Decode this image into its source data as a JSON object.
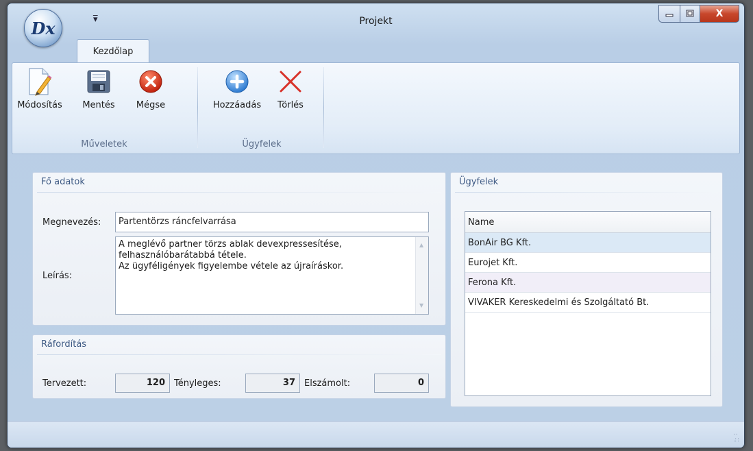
{
  "window": {
    "title": "Projekt",
    "app_logo_text": "Dx",
    "qat_icon": "qat-dropdown-icon",
    "close_glyph": "X"
  },
  "ribbon": {
    "tab": "Kezdőlap",
    "groups": [
      {
        "label": "Műveletek",
        "buttons": [
          {
            "label": "Módosítás",
            "icon": "edit-document-icon"
          },
          {
            "label": "Mentés",
            "icon": "save-disk-icon"
          },
          {
            "label": "Mégse",
            "icon": "cancel-icon"
          }
        ]
      },
      {
        "label": "Ügyfelek",
        "buttons": [
          {
            "label": "Hozzáadás",
            "icon": "add-icon"
          },
          {
            "label": "Törlés",
            "icon": "delete-icon"
          }
        ]
      }
    ]
  },
  "main_data": {
    "title": "Fő adatok",
    "name_label": "Megnevezés:",
    "name_value": "Partentörzs ráncfelvarrása",
    "desc_label": "Leírás:",
    "desc_lines": [
      "A meglévő partner törzs ablak devexpressesítése,",
      "felhasználóbarátabbá tétele.",
      "Az ügyféligények figyelembe vétele az újraíráskor."
    ]
  },
  "effort": {
    "title": "Ráfordítás",
    "planned_label": "Tervezett:",
    "planned_value": "120",
    "actual_label": "Tényleges:",
    "actual_value": "37",
    "billed_label": "Elszámolt:",
    "billed_value": "0"
  },
  "customers": {
    "title": "Ügyfelek",
    "column": "Name",
    "rows": [
      "BonAir BG Kft.",
      "Eurojet Kft.",
      "Ferona Kft.",
      "VIVAKER Kereskedelmi és Szolgáltató Bt."
    ]
  },
  "colors": {
    "accent": "#3e5a84",
    "close_red": "#c8472c",
    "selected_row": "#dbe9f6"
  }
}
